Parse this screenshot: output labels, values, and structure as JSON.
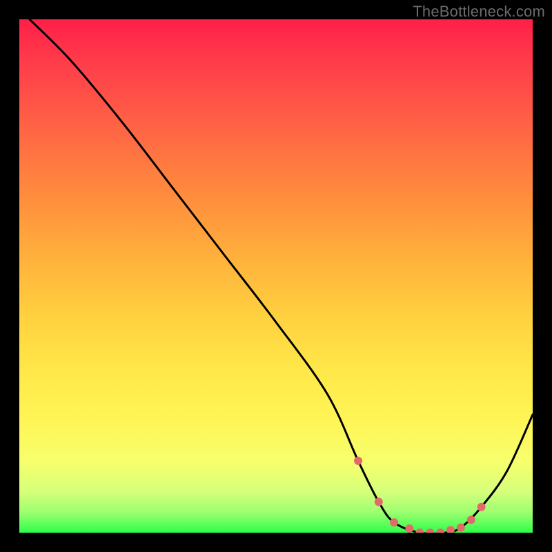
{
  "watermark": "TheBottleneck.com",
  "chart_data": {
    "type": "line",
    "title": "",
    "xlabel": "",
    "ylabel": "",
    "xlim": [
      0,
      100
    ],
    "ylim": [
      0,
      100
    ],
    "grid": false,
    "legend": false,
    "series": [
      {
        "name": "curve",
        "color": "#000000",
        "x": [
          2,
          10,
          20,
          30,
          40,
          50,
          60,
          66,
          70,
          73,
          78,
          83,
          86,
          90,
          95,
          100
        ],
        "y": [
          100,
          92,
          80,
          67,
          54,
          41,
          27,
          14,
          6,
          2,
          0,
          0,
          1,
          5,
          12,
          23
        ]
      }
    ],
    "markers": {
      "name": "highlight-dots",
      "color": "#e46a6a",
      "x": [
        66,
        70,
        73,
        76,
        78,
        80,
        82,
        84,
        86,
        88,
        90
      ],
      "y": [
        14,
        6,
        2,
        0.8,
        0,
        0,
        0,
        0.5,
        1,
        2.5,
        5
      ]
    }
  }
}
